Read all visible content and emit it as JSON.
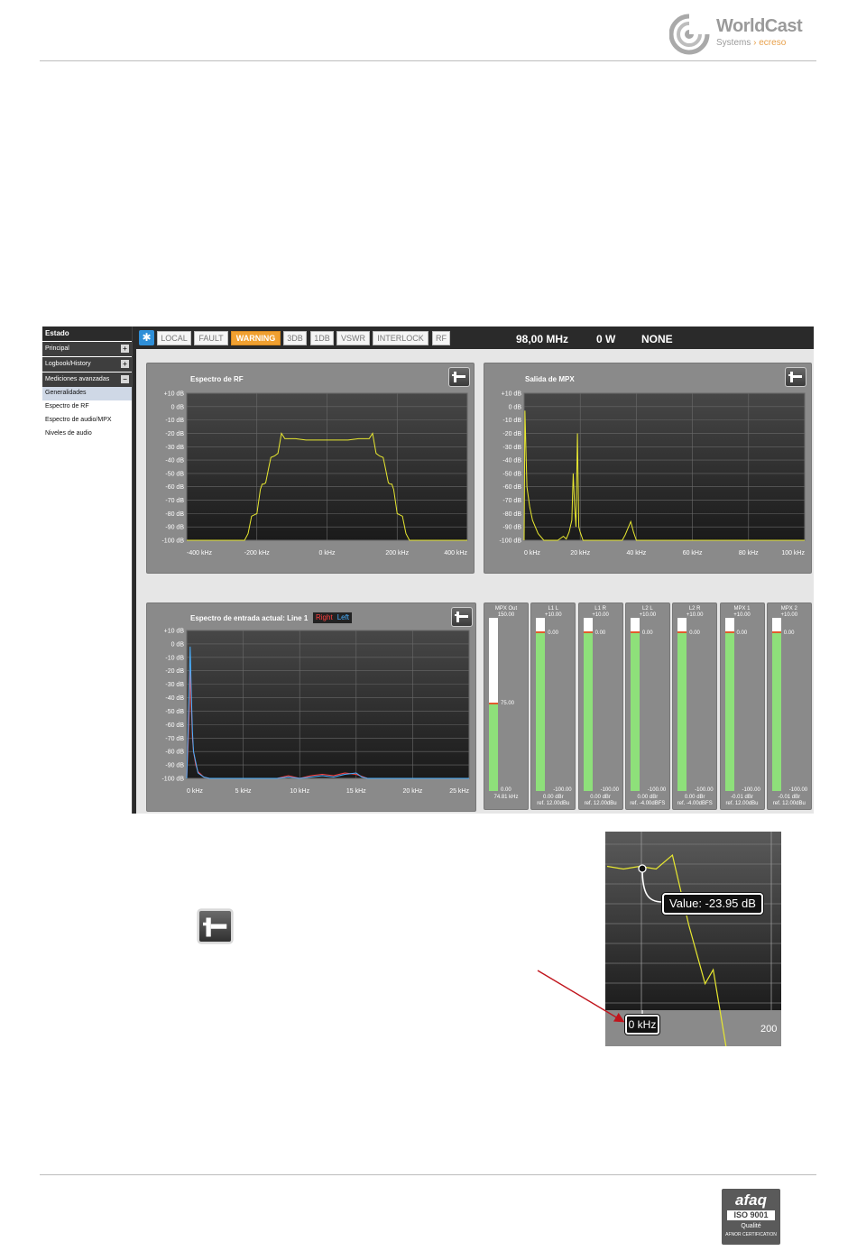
{
  "header": {
    "brand_name": "WorldCast",
    "brand_sub_left": "Systems",
    "brand_sub_sep": "›",
    "brand_sub_right": "ecreso"
  },
  "footer": {
    "cert_afaq": "afaq",
    "cert_iso": "ISO 9001",
    "cert_quality": "Qualité",
    "cert_note": "AFNOR CERTIFICATION"
  },
  "sidebar": {
    "title": "Estado",
    "sections": [
      {
        "label": "Principal",
        "toggle": "+"
      },
      {
        "label": "Logbook/History",
        "toggle": "+"
      },
      {
        "label": "Mediciones avanzadas",
        "toggle": "−"
      }
    ],
    "items": [
      {
        "label": "Generalidades",
        "active": true
      },
      {
        "label": "Espectro de RF"
      },
      {
        "label": "Espectro de audio/MPX"
      },
      {
        "label": "Niveles de audio"
      }
    ]
  },
  "topbar": {
    "icon": "network-icon",
    "tags": [
      "LOCAL",
      "FAULT",
      "WARNING",
      "3DB",
      "1DB",
      "VSWR",
      "INTERLOCK",
      "RF"
    ],
    "frequency": "98,00 MHz",
    "power": "0 W",
    "mode": "NONE",
    "warning_color": "#f0a030"
  },
  "panels": {
    "rf": {
      "title": "Espectro de RF"
    },
    "mpx": {
      "title": "Salida de MPX"
    },
    "audio": {
      "title": "Espectro de entrada actual: Line 1",
      "legend_right": "Right",
      "legend_left": "Left"
    }
  },
  "meters": [
    {
      "name": "MPX Out",
      "top": "150.00",
      "mid": "75.00",
      "bottom": "0.00",
      "f1": "74.81 kHz",
      "f2": "",
      "level": 0.5
    },
    {
      "name": "L1 L",
      "top": "+10.00",
      "mid": "0.00",
      "bottom": "-100.00",
      "f1": "0.00 dBr",
      "f2": "ref. 12.00dBu",
      "level": 0.91
    },
    {
      "name": "L1 R",
      "top": "+10.00",
      "mid": "0.00",
      "bottom": "-100.00",
      "f1": "0.00 dBr",
      "f2": "ref. 12.00dBu",
      "level": 0.91
    },
    {
      "name": "L2 L",
      "top": "+10.00",
      "mid": "0.00",
      "bottom": "-100.00",
      "f1": "0.00 dBr",
      "f2": "ref. -4.00dBFS",
      "level": 0.91
    },
    {
      "name": "L2 R",
      "top": "+10.00",
      "mid": "0.00",
      "bottom": "-100.00",
      "f1": "0.00 dBr",
      "f2": "ref. -4.00dBFS",
      "level": 0.91
    },
    {
      "name": "MPX 1",
      "top": "+10.00",
      "mid": "0.00",
      "bottom": "-100.00",
      "f1": "-0.01 dBr",
      "f2": "ref. 12.00dBu",
      "level": 0.91
    },
    {
      "name": "MPX 2",
      "top": "+10.00",
      "mid": "0.00",
      "bottom": "-100.00",
      "f1": "-0.01 dBr",
      "f2": "ref. 12.00dBu",
      "level": 0.91
    }
  ],
  "zoom_detail": {
    "tooltip": "Value: -23.95 dB",
    "x_label": "0 kHz",
    "x_label_right": "200"
  },
  "chart_data": [
    {
      "type": "line",
      "title": "Espectro de RF",
      "x_ticks": [
        "-400 kHz",
        "-200 kHz",
        "0 kHz",
        "200 kHz",
        "400 kHz"
      ],
      "y_ticks": [
        "+10 dB",
        "0 dB",
        "-10 dB",
        "-20 dB",
        "-30 dB",
        "-40 dB",
        "-50 dB",
        "-60 dB",
        "-70 dB",
        "-80 dB",
        "-90 dB",
        "-100 dB"
      ],
      "xlim": [
        -400,
        400
      ],
      "ylim": [
        -100,
        10
      ],
      "grid": true,
      "series": [
        {
          "color": "#e8e830",
          "x": [
            -400,
            -235,
            -225,
            -215,
            -200,
            -190,
            -185,
            -180,
            -175,
            -165,
            -160,
            -150,
            -140,
            -130,
            -120,
            -90,
            -60,
            -30,
            0,
            30,
            60,
            90,
            120,
            130,
            140,
            150,
            160,
            165,
            175,
            180,
            185,
            190,
            200,
            215,
            225,
            235,
            400
          ],
          "y": [
            -100,
            -100,
            -95,
            -82,
            -80,
            -62,
            -58,
            -58,
            -57,
            -44,
            -38,
            -37,
            -35,
            -20,
            -24,
            -24,
            -25,
            -25,
            -25,
            -25,
            -25,
            -24,
            -24,
            -20,
            -35,
            -37,
            -38,
            -44,
            -57,
            -58,
            -58,
            -62,
            -80,
            -82,
            -95,
            -100,
            -100
          ]
        }
      ]
    },
    {
      "type": "line",
      "title": "Salida de MPX",
      "x_ticks": [
        "0 kHz",
        "20 kHz",
        "40 kHz",
        "60 kHz",
        "80 kHz",
        "100 kHz"
      ],
      "y_ticks": [
        "+10 dB",
        "0 dB",
        "-10 dB",
        "-20 dB",
        "-30 dB",
        "-40 dB",
        "-50 dB",
        "-60 dB",
        "-70 dB",
        "-80 dB",
        "-90 dB",
        "-100 dB"
      ],
      "xlim": [
        0,
        100
      ],
      "ylim": [
        -100,
        10
      ],
      "grid": true,
      "series": [
        {
          "color": "#e8e830",
          "x": [
            0,
            0.3,
            1,
            2,
            3,
            5,
            7,
            10,
            12,
            14,
            15,
            16,
            17,
            17.5,
            18,
            18.5,
            19,
            19.5,
            20,
            21,
            22,
            23,
            35,
            36,
            37,
            38,
            39,
            40,
            100
          ],
          "y": [
            -100,
            -3,
            -60,
            -75,
            -85,
            -95,
            -100,
            -100,
            -100,
            -97,
            -99,
            -94,
            -85,
            -50,
            -75,
            -90,
            -20,
            -90,
            -94,
            -100,
            -100,
            -100,
            -100,
            -96,
            -91,
            -86,
            -94,
            -100,
            -100
          ]
        }
      ]
    },
    {
      "type": "line",
      "title": "Espectro de entrada actual: Line 1",
      "x_ticks": [
        "0 kHz",
        "5 kHz",
        "10 kHz",
        "15 kHz",
        "20 kHz",
        "25 kHz"
      ],
      "y_ticks": [
        "+10 dB",
        "0 dB",
        "-10 dB",
        "-20 dB",
        "-30 dB",
        "-40 dB",
        "-50 dB",
        "-60 dB",
        "-70 dB",
        "-80 dB",
        "-90 dB",
        "-100 dB"
      ],
      "xlim": [
        0,
        25
      ],
      "ylim": [
        -100,
        10
      ],
      "grid": true,
      "series": [
        {
          "name": "Right",
          "color": "#ff4040",
          "x": [
            0,
            0.1,
            0.2,
            0.3,
            0.4,
            0.5,
            0.6,
            0.8,
            1.0,
            1.5,
            2,
            4,
            8,
            9,
            10,
            11,
            12,
            13,
            14,
            15,
            16,
            17,
            25
          ],
          "y": [
            -100,
            -80,
            -55,
            -20,
            -45,
            -70,
            -80,
            -90,
            -95,
            -99,
            -100,
            -100,
            -100,
            -98,
            -100,
            -98,
            -97,
            -98,
            -96,
            -97,
            -100,
            -100,
            -100
          ]
        },
        {
          "name": "Left",
          "color": "#4ab0ff",
          "x": [
            0,
            0.1,
            0.2,
            0.3,
            0.4,
            0.5,
            0.6,
            0.8,
            1.0,
            1.5,
            2,
            4,
            8,
            9,
            10,
            11,
            12,
            13,
            14,
            15,
            15.5,
            16,
            17,
            25
          ],
          "y": [
            -100,
            -70,
            -40,
            -2,
            -35,
            -65,
            -80,
            -88,
            -96,
            -99,
            -100,
            -100,
            -100,
            -99,
            -100,
            -99,
            -98,
            -99,
            -97,
            -96,
            -99,
            -100,
            -100,
            -100
          ]
        }
      ]
    },
    {
      "type": "line",
      "title": "",
      "x_ticks": [
        "0 kHz",
        "200"
      ],
      "grid": true,
      "series": [
        {
          "color": "#e8e830",
          "x": [
            0,
            20,
            40,
            60,
            80,
            100,
            120,
            130,
            150,
            170,
            190,
            210
          ],
          "y": [
            -24,
            -24,
            -24,
            -24,
            -22,
            -34,
            -45,
            -42,
            -60,
            -75,
            -82,
            -100
          ]
        }
      ]
    }
  ]
}
